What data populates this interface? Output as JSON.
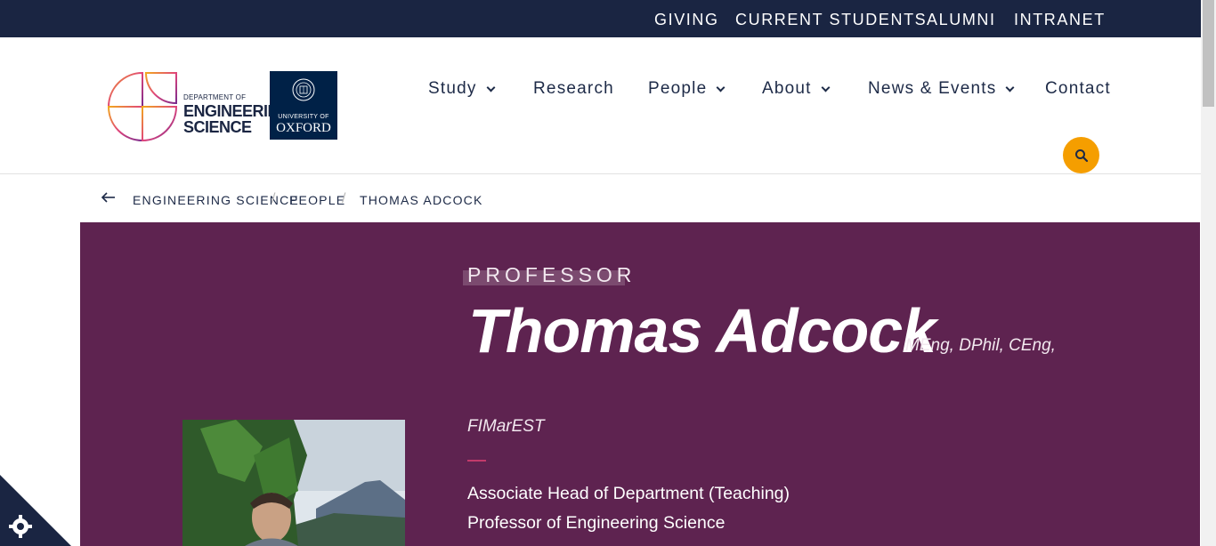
{
  "topbar": {
    "links": [
      "GIVING",
      "CURRENT STUDENTS",
      "ALUMNI",
      "INTRANET"
    ]
  },
  "logo": {
    "dept_line1": "DEPARTMENT OF",
    "dept_line2": "ENGINEERING",
    "dept_line3": "SCIENCE",
    "uni_line1": "UNIVERSITY OF",
    "uni_line2": "OXFORD"
  },
  "nav": {
    "study": "Study",
    "research": "Research",
    "people": "People",
    "about": "About",
    "news": "News & Events",
    "contact": "Contact"
  },
  "breadcrumb": {
    "items": [
      "ENGINEERING SCIENCE",
      "PEOPLE",
      "THOMAS ADCOCK"
    ]
  },
  "profile": {
    "role": "PROFESSOR",
    "name": "Thomas Adcock",
    "postnominals_line1": "MEng, DPhil, CEng,",
    "postnominals_line2": "FIMarEST",
    "titles": [
      "Associate Head of Department (Teaching)",
      "Professor of Engineering Science"
    ]
  },
  "colors": {
    "topbar": "#1a2542",
    "hero": "#5e2350",
    "search": "#f59e00",
    "accent": "#c23a6b"
  }
}
